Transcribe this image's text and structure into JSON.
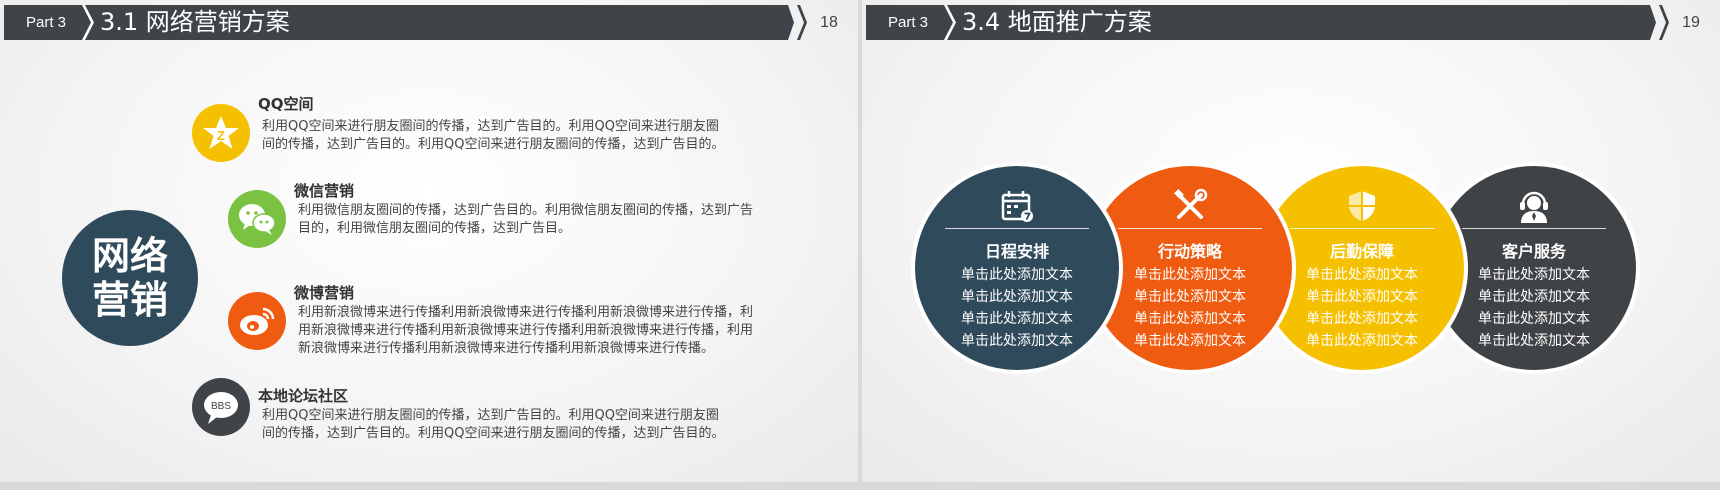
{
  "left_slide": {
    "part": "Part 3",
    "title": "3.1 网络营销方案",
    "page_number": "18",
    "center_label": [
      "网络",
      "营销"
    ],
    "items": [
      {
        "title": "QQ空间",
        "desc": [
          "利用QQ空间来进行朋友圈间的传播，达到广告目的。利用QQ空间来进行朋友圈",
          "间的传播，达到广告目的。利用QQ空间来进行朋友圈间的传播，达到广告目的。"
        ],
        "icon": "qzone-star-icon",
        "color": "#f5c000"
      },
      {
        "title": "微信营销",
        "desc": [
          "利用微信朋友圈间的传播，达到广告目的。利用微信朋友圈间的传播，达到广告",
          "目的，利用微信朋友圈间的传播，达到广告目。"
        ],
        "icon": "wechat-icon",
        "color": "#7cc242"
      },
      {
        "title": "微博营销",
        "desc": [
          "利用新浪微博来进行传播利用新浪微博来进行传播利用新浪微博来进行传播，利",
          "用新浪微博来进行传播利用新浪微博来进行传播利用新浪微博来进行传播，利用",
          "新浪微博来进行传播利用新浪微博来进行传播利用新浪微博来进行传播。"
        ],
        "icon": "weibo-icon",
        "color": "#ef5b10"
      },
      {
        "title": "本地论坛社区",
        "desc": [
          "利用QQ空间来进行朋友圈间的传播，达到广告目的。利用QQ空间来进行朋友圈",
          "间的传播，达到广告目的。利用QQ空间来进行朋友圈间的传播，达到广告目的。"
        ],
        "icon": "bbs-bubble-icon",
        "icon_text": "BBS",
        "color": "#3f4449"
      }
    ]
  },
  "right_slide": {
    "part": "Part 3",
    "title": "3.4 地面推广方案",
    "page_number": "19",
    "services": [
      {
        "title": "日程安排",
        "lines": [
          "单击此处添加文本",
          "单击此处添加文本",
          "单击此处添加文本",
          "单击此处添加文本"
        ],
        "icon": "calendar-icon",
        "color": "#2f4a5b"
      },
      {
        "title": "行动策略",
        "lines": [
          "单击此处添加文本",
          "单击此处添加文本",
          "单击此处添加文本",
          "单击此处添加文本"
        ],
        "icon": "tools-icon",
        "color": "#ef5b10"
      },
      {
        "title": "后勤保障",
        "lines": [
          "单击此处添加文本",
          "单击此处添加文本",
          "单击此处添加文本",
          "单击此处添加文本"
        ],
        "icon": "shield-icon",
        "color": "#f5c000"
      },
      {
        "title": "客户服务",
        "lines": [
          "单击此处添加文本",
          "单击此处添加文本",
          "单击此处添加文本",
          "单击此处添加文本"
        ],
        "icon": "headset-agent-icon",
        "color": "#404346"
      }
    ]
  }
}
